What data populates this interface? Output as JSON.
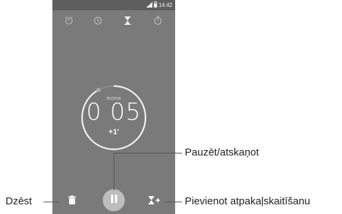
{
  "status_bar": {
    "time": "14:42"
  },
  "tabs": [
    {
      "icon": "alarm-clock-icon"
    },
    {
      "icon": "clock-icon"
    },
    {
      "icon": "hourglass-icon"
    },
    {
      "icon": "stopwatch-icon"
    }
  ],
  "timer": {
    "label": "Iezīme",
    "value": "0 05",
    "add_minute_label": "+1'",
    "progress": 0.92
  },
  "bottom_bar": {
    "delete_icon": "trash-icon",
    "pause_icon": "pause-icon",
    "add_timer_icon": "add-timer-icon"
  },
  "callouts": {
    "delete": "Dzēst",
    "pause_resume": "Pauzēt/atskaņot",
    "add_timer": "Pievienot atpakaļskaitīšanu"
  },
  "colors": {
    "screen_bg": "#7a7a7a",
    "status_bar_bg": "#5e5e5e",
    "ring": "#f2f2f2",
    "accent_tab": "#ffffff",
    "inactive_tab": "#c8c8c8"
  }
}
